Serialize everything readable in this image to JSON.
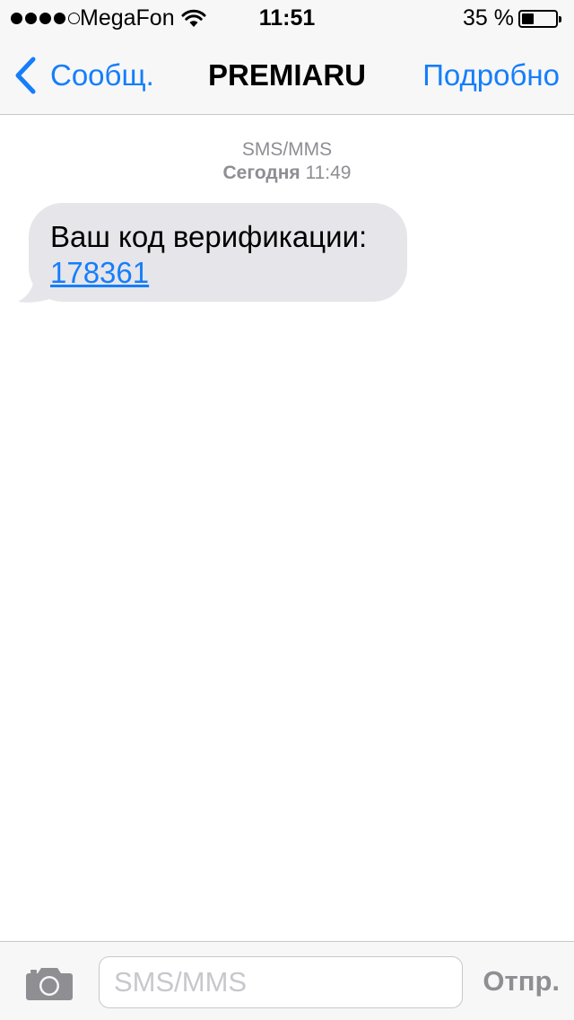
{
  "status_bar": {
    "carrier": "MegaFon",
    "time": "11:51",
    "battery_percent_text": "35 %",
    "battery_level": 0.35,
    "signal_bars_filled": 4,
    "signal_bars_total": 5
  },
  "nav": {
    "back_label": "Сообщ.",
    "title": "PREMIARU",
    "details_label": "Подробно"
  },
  "conversation": {
    "service": "SMS/MMS",
    "day": "Сегодня",
    "time": "11:49",
    "message_text": "Ваш код верификации:",
    "message_code": "178361"
  },
  "input_bar": {
    "placeholder": "SMS/MMS",
    "value": "",
    "send_label": "Отпр."
  },
  "colors": {
    "accent": "#157efb",
    "bubble": "#e5e5ea",
    "meta_text": "#8e8e93",
    "bar_background": "#f7f7f7"
  },
  "icons": [
    "back-chevron-icon",
    "wifi-icon",
    "battery-icon",
    "camera-icon"
  ]
}
